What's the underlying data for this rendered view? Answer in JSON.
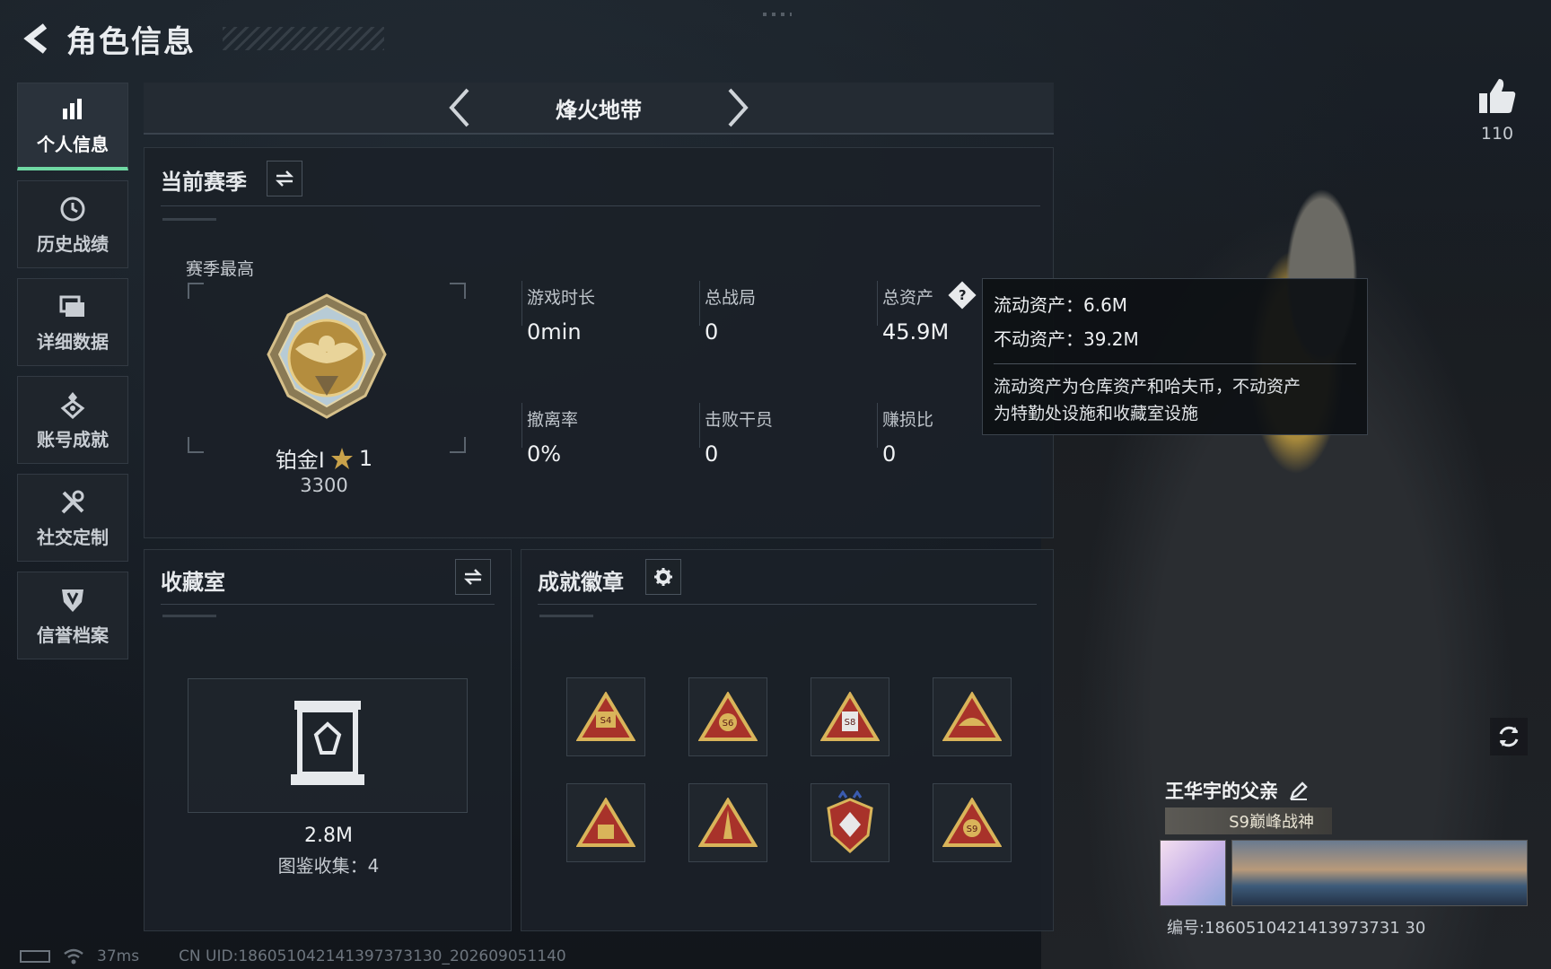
{
  "header": {
    "title": "角色信息"
  },
  "sidebar": {
    "items": [
      {
        "label": "个人信息",
        "icon": "bar-chart-icon",
        "active": true
      },
      {
        "label": "历史战绩",
        "icon": "clock-history-icon",
        "active": false
      },
      {
        "label": "详细数据",
        "icon": "folder-icon",
        "active": false
      },
      {
        "label": "账号成就",
        "icon": "medal-icon",
        "active": false
      },
      {
        "label": "社交定制",
        "icon": "tools-icon",
        "active": false
      },
      {
        "label": "信誉档案",
        "icon": "shield-icon",
        "active": false
      }
    ]
  },
  "mode": {
    "name": "烽火地带"
  },
  "season": {
    "title": "当前赛季",
    "best_label": "赛季最高",
    "rank_name": "铂金I",
    "rank_stars": "1",
    "rank_score": "3300",
    "stats": [
      {
        "label": "游戏时长",
        "value": "0min"
      },
      {
        "label": "总战局",
        "value": "0"
      },
      {
        "label": "总资产",
        "value": "45.9M"
      },
      {
        "label": "撤离率",
        "value": "0%"
      },
      {
        "label": "击败干员",
        "value": "0"
      },
      {
        "label": "赚损比",
        "value": "0"
      }
    ]
  },
  "tooltip": {
    "liquid": "流动资产：6.6M",
    "fixed": "不动资产：39.2M",
    "desc_line1": "流动资产为仓库资产和哈夫币，不动资产",
    "desc_line2": "为特勤处设施和收藏室设施"
  },
  "collection": {
    "title": "收藏室",
    "value": "2.8M",
    "count": "图鉴收集：4"
  },
  "badges": {
    "title": "成就徽章",
    "items": [
      "S4",
      "S6",
      "S8",
      "",
      "",
      "",
      "",
      "S9"
    ]
  },
  "player": {
    "likes": "110",
    "name": "王华宇的父亲",
    "title_tag": "S9巅峰战神",
    "card_id": "编号:1860510421413973731 30"
  },
  "footer": {
    "ping": "37ms",
    "uid": "CN UID:186051042141397373130_202609051140"
  },
  "colors": {
    "accent": "#6fd8a3",
    "gold": "#c9a24a",
    "panel": "#1b2128"
  }
}
